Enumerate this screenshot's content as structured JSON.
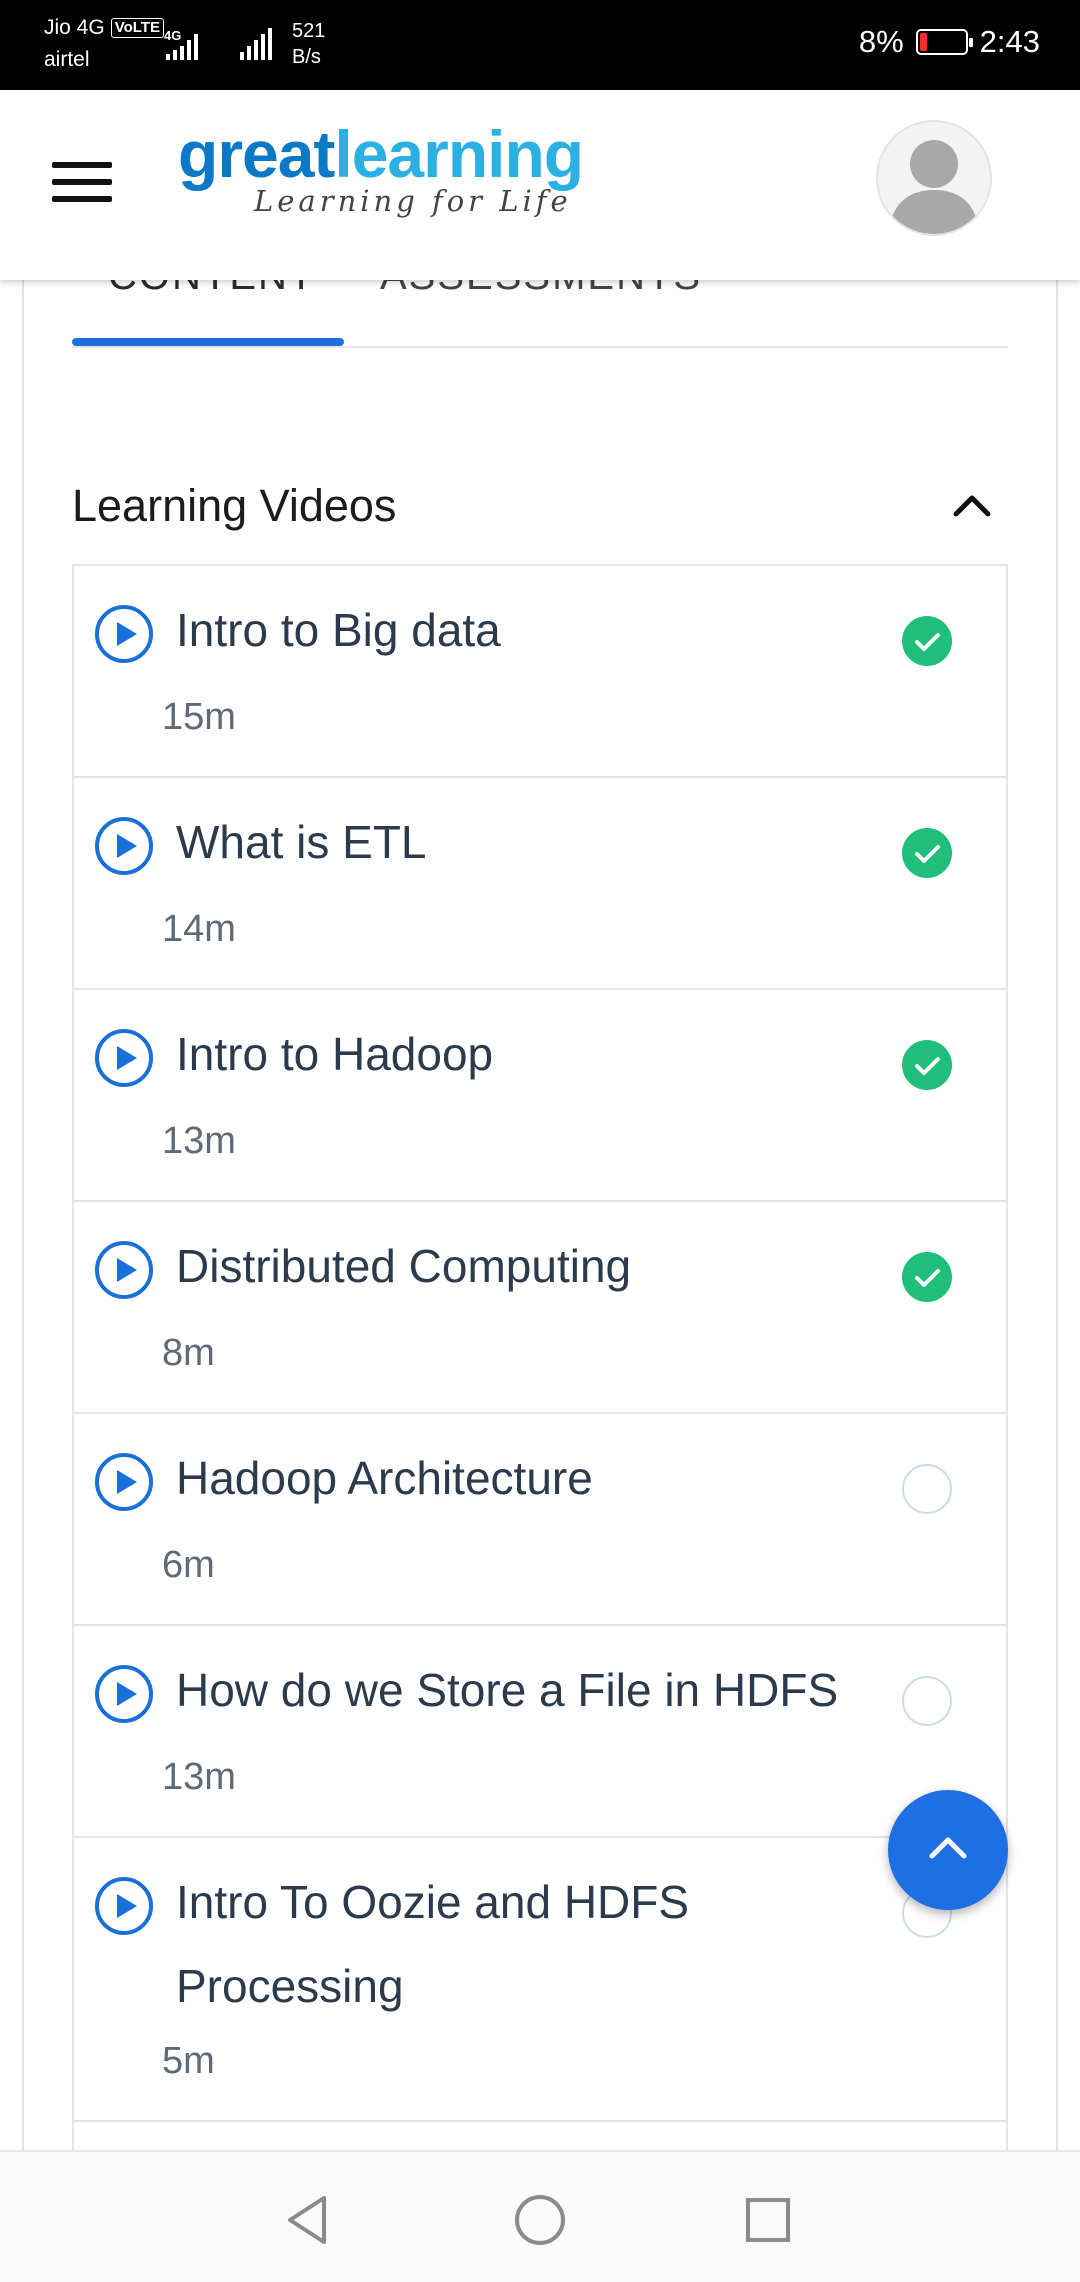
{
  "status_bar": {
    "carrier1": "Jio 4G",
    "volte": "VoLTE",
    "carrier2": "airtel",
    "net_speed_value": "521",
    "net_speed_unit": "B/s",
    "battery": "8%",
    "time": "2:43"
  },
  "header": {
    "logo_part1": "great",
    "logo_part2": "learning",
    "tagline": "Learning for Life"
  },
  "tabs": [
    {
      "label": "CONTENT",
      "active": true
    },
    {
      "label": "ASSESSMENTS",
      "active": false
    }
  ],
  "section": {
    "title": "Learning Videos"
  },
  "videos": [
    {
      "title": "Intro to Big data",
      "duration": "15m",
      "completed": true
    },
    {
      "title": "What is ETL",
      "duration": "14m",
      "completed": true
    },
    {
      "title": "Intro to Hadoop",
      "duration": "13m",
      "completed": true
    },
    {
      "title": "Distributed Computing",
      "duration": "8m",
      "completed": true
    },
    {
      "title": "Hadoop Architecture",
      "duration": "6m",
      "completed": false
    },
    {
      "title": "How do we Store a File in HDFS",
      "duration": "13m",
      "completed": false
    },
    {
      "title": "Intro To Oozie and HDFS Processing",
      "duration": "5m",
      "completed": false
    }
  ],
  "colors": {
    "accent": "#1a6fd8",
    "complete": "#1fbf7a",
    "fab": "#1e6fe3"
  }
}
